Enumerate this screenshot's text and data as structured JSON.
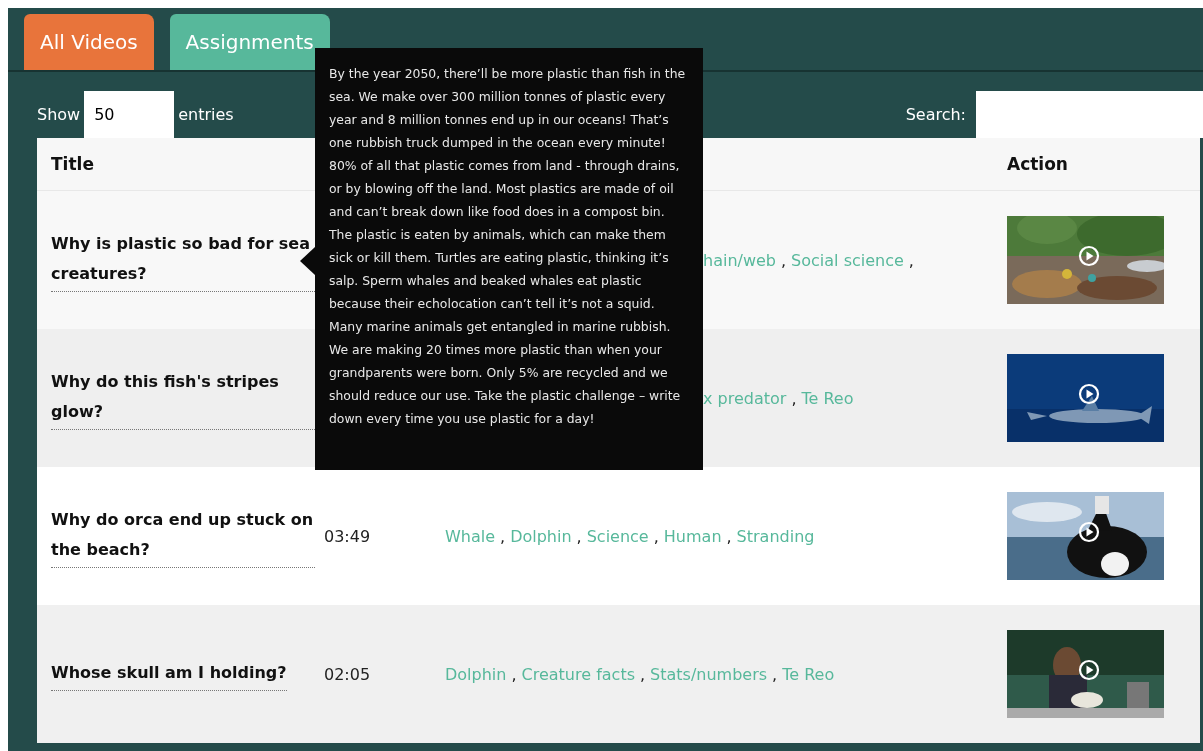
{
  "tabs": [
    {
      "label": "All Videos",
      "selected": true
    },
    {
      "label": "Assignments",
      "selected": false
    }
  ],
  "length_control": {
    "label_before": "Show",
    "value": "50",
    "label_after": "entries"
  },
  "search": {
    "label": "Search:"
  },
  "table": {
    "columns": [
      {
        "label": "Title"
      },
      {
        "label": "Action"
      }
    ],
    "rows": [
      {
        "title": "Why is plastic so bad for sea creatures?",
        "covered": true,
        "tags": [
          {
            "label": "hain/web",
            "separator": ","
          },
          {
            "label": "Social science",
            "separator": ","
          }
        ]
      },
      {
        "title": "Why do this fish's stripes glow?",
        "covered": true,
        "tags": [
          {
            "label": "x predator",
            "separator": ","
          },
          {
            "label": "Te Reo"
          }
        ]
      },
      {
        "title": "Why do orca end up stuck on the beach?",
        "covered": false,
        "duration": "03:49",
        "tags": [
          {
            "label": "Whale",
            "separator": ","
          },
          {
            "label": "Dolphin",
            "separator": ","
          },
          {
            "label": "Science",
            "separator": ","
          },
          {
            "label": "Human",
            "separator": ","
          },
          {
            "label": "Stranding"
          }
        ]
      },
      {
        "title": "Whose skull am I holding?",
        "covered": false,
        "duration": "02:05",
        "tags": [
          {
            "label": "Dolphin",
            "separator": ","
          },
          {
            "label": "Creature facts",
            "separator": ","
          },
          {
            "label": "Stats/numbers",
            "separator": ","
          },
          {
            "label": "Te Reo"
          }
        ]
      }
    ]
  },
  "tooltip": {
    "text": "By the year 2050, there’ll be more plastic than fish in the sea. We make over 300 million tonnes of plastic every year and 8 million tonnes end up in our oceans! That’s one rubbish truck dumped in the ocean every minute! 80% of all that plastic comes from land - through drains, or by blowing off the land. Most plastics are made of oil and can’t break down like food does in a compost bin. The plastic is eaten by animals, which can make them sick or kill them. Turtles are eating plastic, thinking it’s salp. Sperm whales and beaked whales eat plastic because their echolocation can’t tell it’s not a squid. Many marine animals get entangled in marine rubbish. We are making 20 times more plastic than when your grandparents were born. Only 5% are recycled and we should reduce our use. Take the plastic challenge – write down every time you use plastic for a day!"
  }
}
